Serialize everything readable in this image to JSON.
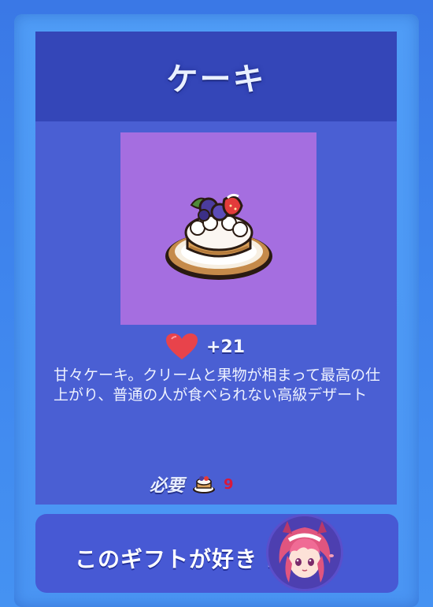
{
  "gift": {
    "title": "ケーキ",
    "item_icon": "cake-icon",
    "affinity_icon": "heart-icon",
    "affinity_bonus": "+21",
    "description": "甘々ケーキ。クリームと果物が相まって最高の仕上がり、普通の人が食べられない高級デザート",
    "required_label": "必要",
    "required_icon": "cake-icon",
    "required_count": "9"
  },
  "likes": {
    "label": "このギフトが好き      :",
    "avatar_icon": "character-avatar"
  },
  "colors": {
    "title_bar": "#3446b8",
    "card": "#4a5fd3",
    "image_bg": "#a56ee0",
    "heart": "#e8434b",
    "count": "#d8183a"
  }
}
